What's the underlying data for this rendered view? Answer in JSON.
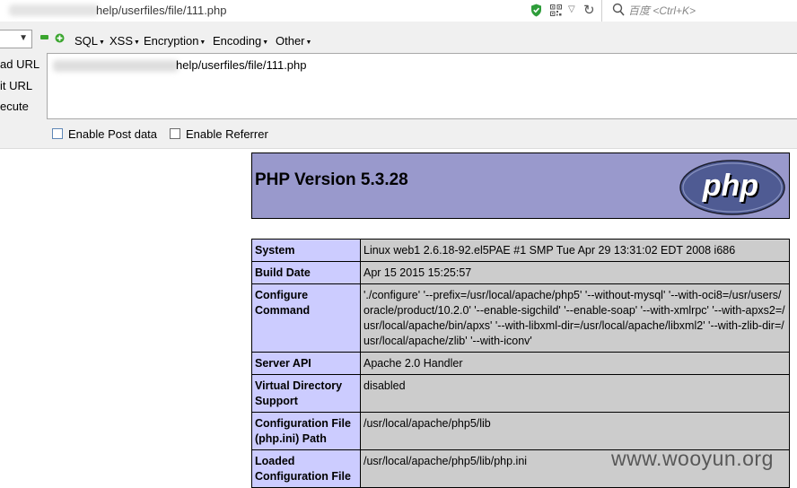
{
  "address_bar": {
    "url_suffix": "help/userfiles/file/111.php",
    "search_placeholder": "百度 <Ctrl+K>"
  },
  "hackbar": {
    "menus": [
      {
        "label": "SQL"
      },
      {
        "label": "XSS"
      },
      {
        "label": "Encryption"
      },
      {
        "label": "Encoding"
      },
      {
        "label": "Other"
      }
    ],
    "side_labels": {
      "load": "ad URL",
      "split": "it URL",
      "execute": "ecute"
    },
    "url_value_suffix": "help/userfiles/file/111.php",
    "enable_post": "Enable Post data",
    "enable_referrer": "Enable Referrer"
  },
  "phpinfo": {
    "title": "PHP Version 5.3.28",
    "logo_text": "php",
    "rows": [
      {
        "key": "System",
        "value": "Linux web1 2.6.18-92.el5PAE #1 SMP Tue Apr 29 13:31:02 EDT 2008 i686"
      },
      {
        "key": "Build Date",
        "value": "Apr 15 2015 15:25:57"
      },
      {
        "key": "Configure Command",
        "value": "'./configure' '--prefix=/usr/local/apache/php5' '--without-mysql' '--with-oci8=/usr/users/oracle/product/10.2.0' '--enable-sigchild' '--enable-soap' '--with-xmlrpc' '--with-apxs2=/usr/local/apache/bin/apxs' '--with-libxml-dir=/usr/local/apache/libxml2' '--with-zlib-dir=/usr/local/apache/zlib' '--with-iconv'"
      },
      {
        "key": "Server API",
        "value": "Apache 2.0 Handler"
      },
      {
        "key": "Virtual Directory Support",
        "value": "disabled"
      },
      {
        "key": "Configuration File (php.ini) Path",
        "value": "/usr/local/apache/php5/lib"
      },
      {
        "key": "Loaded Configuration File",
        "value": "/usr/local/apache/php5/lib/php.ini"
      }
    ]
  },
  "watermark": "www.wooyun.org",
  "colors": {
    "php_header_bg": "#9999cc",
    "key_cell_bg": "#ccccff",
    "value_cell_bg": "#cccccc",
    "hackbar_bg": "#f0f0f0",
    "shield_green": "#2e9d3a"
  },
  "icons": [
    "shield-icon",
    "qr-code-icon",
    "dropdown-arrow-icon",
    "reload-icon",
    "search-icon",
    "minus-icon",
    "plus-icon",
    "php-logo"
  ]
}
